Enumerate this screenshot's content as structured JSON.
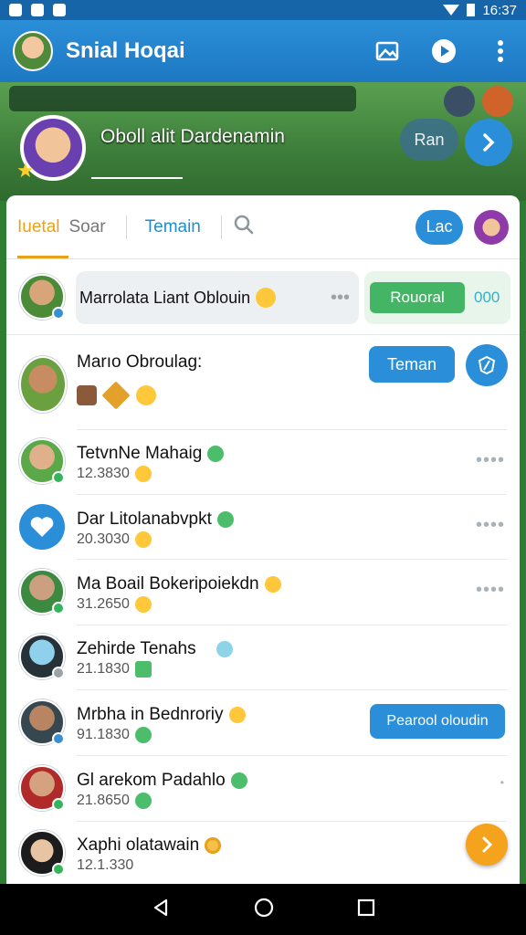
{
  "status_bar": {
    "time": "16:37"
  },
  "app_bar": {
    "title": "Snial Hoqai"
  },
  "banner": {
    "name": "Oboll alit Dardenamin",
    "pill_label": "Ran"
  },
  "tabs": {
    "items": [
      {
        "label": "Iuetal"
      },
      {
        "label": "Soar"
      },
      {
        "label": "Temain"
      }
    ],
    "right_button": "Lac"
  },
  "first_row": {
    "name": "Marrolata Liant Oblouin",
    "action_label": "Rouoral",
    "action_count": "000"
  },
  "chats": [
    {
      "name": "Marıo Obroulag:",
      "sub": "",
      "button": "Teman"
    },
    {
      "name": "TetvnNe Mahaig",
      "sub": "12.3830"
    },
    {
      "name": "Dar Litolanabvpkt",
      "sub": "20.3030"
    },
    {
      "name": "Ma Boail Bokeripoiekdn",
      "sub": "31.2650"
    },
    {
      "name": "Zehirde Tenahs",
      "sub": "21.1830"
    },
    {
      "name": "Mrbha in Bednroriy",
      "sub": "91.1830",
      "button": "Pearool oloudin"
    },
    {
      "name": "Gl arekom Padahlo",
      "sub": "21.8650"
    },
    {
      "name": "Xaphi olatawain",
      "sub": "12.1.330"
    }
  ],
  "colors": {
    "primary": "#2a8fd8",
    "accent": "#e8a21a",
    "green": "#43b565"
  }
}
